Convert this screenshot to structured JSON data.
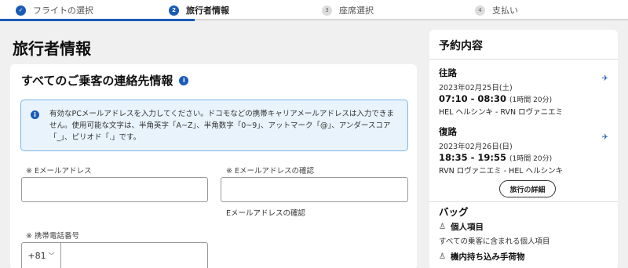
{
  "steps": [
    {
      "num": "✓",
      "label": "フライトの選択",
      "state": "done"
    },
    {
      "num": "2",
      "label": "旅行者情報",
      "state": "active"
    },
    {
      "num": "3",
      "label": "座席選択",
      "state": "pending"
    },
    {
      "num": "4",
      "label": "支払い",
      "state": "pending"
    }
  ],
  "page_title": "旅行者情報",
  "contact": {
    "title": "すべてのご乗客の連絡先情報",
    "info_icon": "i",
    "notice": "有効なPCメールアドレスを入力してください。ドコモなどの携帯キャリアメールアドレスは入力できません。使用可能な文字は、半角英字「A~Z」、半角数字「0~9」、アットマーク「@」、アンダースコア「_」、ピリオド「.」です。",
    "email_label": "※ Eメールアドレス",
    "email_value": "",
    "email_confirm_label": "※ Eメールアドレスの確認",
    "email_confirm_value": "",
    "email_confirm_hint": "Eメールアドレスの確認",
    "phone_label": "※ 携帯電話番号",
    "country_code": "+81",
    "phone_value": ""
  },
  "summary": {
    "title": "予約内容",
    "outbound": {
      "title": "往路",
      "date": "2023年02月25日(土)",
      "time": "07:10 - 08:30",
      "duration": "(1時間 20分)",
      "route": "HEL ヘルシンキ - RVN ロヴァニエミ"
    },
    "return": {
      "title": "復路",
      "date": "2023年02月26日(日)",
      "time": "18:35 - 19:55",
      "duration": "(1時間 20分)",
      "route": "RVN ロヴァニエミ - HEL ヘルシンキ"
    },
    "details_button": "旅行の詳細",
    "bag_title": "バッグ",
    "personal_item": "個人項目",
    "personal_item_desc": "すべての乗客に含まれる個人項目",
    "carry_on": "機内持ち込み手荷物"
  },
  "colors": {
    "accent": "#1a5bb5",
    "notice_bg": "#e8f3fc",
    "notice_border": "#7bb6e6"
  },
  "icons": {
    "check": "check-icon",
    "info": "info-icon",
    "plane": "airplane-icon",
    "bag": "bag-icon",
    "chevron": "chevron-down-icon"
  }
}
